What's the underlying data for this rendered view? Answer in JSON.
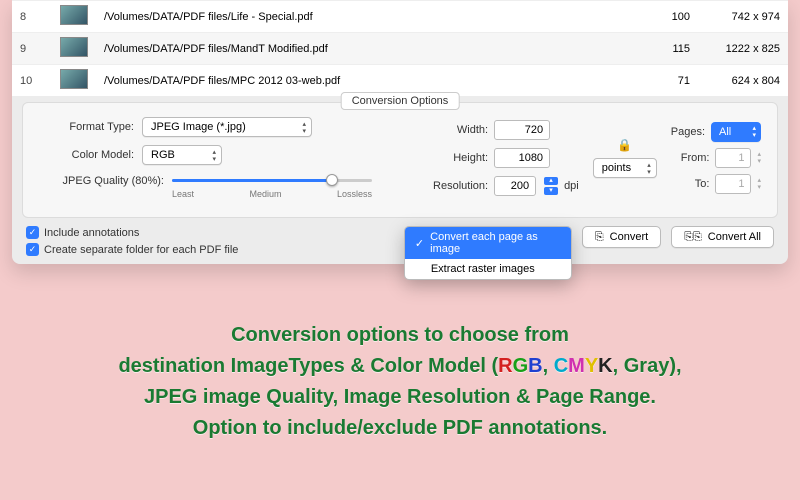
{
  "files": [
    {
      "idx": "8",
      "path": "/Volumes/DATA/PDF files/Life - Special.pdf",
      "pages": "100",
      "dim": "742 x 974"
    },
    {
      "idx": "9",
      "path": "/Volumes/DATA/PDF files/MandT Modified.pdf",
      "pages": "115",
      "dim": "1222 x 825"
    },
    {
      "idx": "10",
      "path": "/Volumes/DATA/PDF files/MPC 2012 03-web.pdf",
      "pages": "71",
      "dim": "624 x 804"
    }
  ],
  "options": {
    "title": "Conversion Options",
    "format_label": "Format Type:",
    "format_value": "JPEG Image (*.jpg)",
    "color_label": "Color Model:",
    "color_value": "RGB",
    "quality_label": "JPEG Quality (80%):",
    "slider_min": "Least",
    "slider_mid": "Medium",
    "slider_max": "Lossless",
    "slider_percent": 80,
    "width_label": "Width:",
    "width_value": "720",
    "height_label": "Height:",
    "height_value": "1080",
    "units_value": "points",
    "resolution_label": "Resolution:",
    "resolution_value": "200",
    "resolution_unit": "dpi",
    "pages_label": "Pages:",
    "pages_value": "All",
    "from_label": "From:",
    "from_value": "1",
    "to_label": "To:",
    "to_value": "1"
  },
  "checks": {
    "annotations": "Include annotations",
    "separate_folder": "Create separate folder for each PDF file"
  },
  "menu": {
    "convert_each": "Convert each page as image",
    "extract_raster": "Extract raster images"
  },
  "buttons": {
    "convert": "Convert",
    "convert_all": "Convert All"
  },
  "promo": {
    "l1a": "Conversion options to choose from",
    "l2a": "destination ImageTypes & Color Model (",
    "l2b": ", ",
    "l2c": ", Gray),",
    "l3": "JPEG image Quality, Image Resolution & Page Range.",
    "l4": "Option to include/exclude PDF annotations."
  }
}
